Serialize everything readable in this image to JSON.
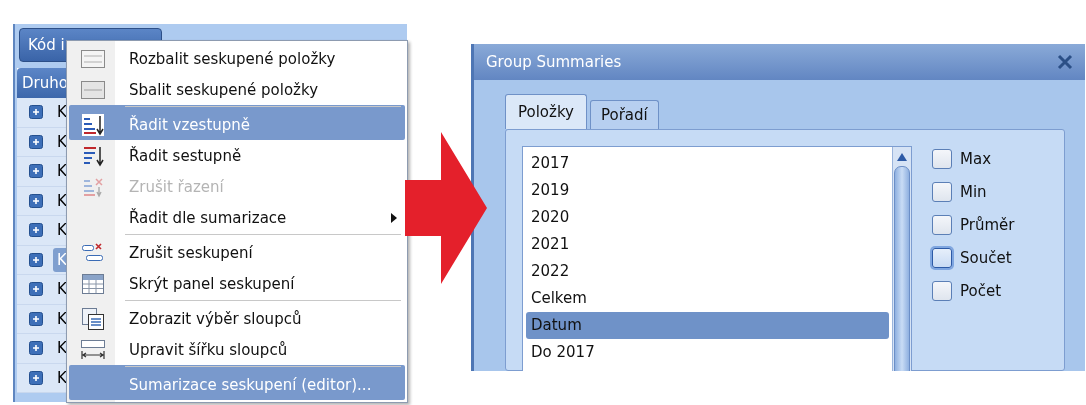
{
  "grid": {
    "group_button": "Kód i",
    "column_header": "Druho",
    "rows": [
      {
        "text": "K",
        "selected": false
      },
      {
        "text": "K",
        "selected": false
      },
      {
        "text": "K",
        "selected": false
      },
      {
        "text": "K",
        "selected": false
      },
      {
        "text": "K",
        "selected": false
      },
      {
        "text": "K",
        "selected": true
      },
      {
        "text": "K",
        "selected": false
      },
      {
        "text": "K",
        "selected": false
      },
      {
        "text": "K",
        "selected": false
      },
      {
        "text": "K",
        "selected": false
      }
    ]
  },
  "context_menu": {
    "items": [
      {
        "kind": "expand",
        "label": "Rozbalit seskupené položky",
        "selected": false,
        "disabled": false,
        "submenu": false,
        "separator_before": false
      },
      {
        "kind": "collapse",
        "label": "Sbalit seskupené položky",
        "selected": false,
        "disabled": false,
        "submenu": false,
        "separator_before": false
      },
      {
        "kind": "sort-asc",
        "label": "Řadit vzestupně",
        "selected": true,
        "disabled": false,
        "submenu": false,
        "separator_before": true
      },
      {
        "kind": "sort-desc",
        "label": "Řadit sestupně",
        "selected": false,
        "disabled": false,
        "submenu": false,
        "separator_before": false
      },
      {
        "kind": "clear-sort",
        "label": "Zrušit řazení",
        "selected": false,
        "disabled": true,
        "submenu": false,
        "separator_before": false
      },
      {
        "kind": "plain",
        "label": "Řadit dle sumarizace",
        "selected": false,
        "disabled": false,
        "submenu": true,
        "separator_before": false
      },
      {
        "kind": "ungroup",
        "label": "Zrušit seskupení",
        "selected": false,
        "disabled": false,
        "submenu": false,
        "separator_before": true
      },
      {
        "kind": "hide-panel",
        "label": "Skrýt panel seskupení",
        "selected": false,
        "disabled": false,
        "submenu": false,
        "separator_before": false
      },
      {
        "kind": "column-chooser",
        "label": "Zobrazit výběr sloupců",
        "selected": false,
        "disabled": false,
        "submenu": false,
        "separator_before": true
      },
      {
        "kind": "best-fit",
        "label": "Upravit šířku sloupců",
        "selected": false,
        "disabled": false,
        "submenu": false,
        "separator_before": false
      },
      {
        "kind": "plain",
        "label": "Sumarizace seskupení (editor)...",
        "selected": true,
        "disabled": false,
        "submenu": false,
        "separator_before": true
      }
    ]
  },
  "dialog": {
    "title": "Group Summaries",
    "tabs": [
      {
        "label": "Položky",
        "selected": true
      },
      {
        "label": "Pořadí",
        "selected": false
      }
    ],
    "list_items": [
      {
        "label": "2017",
        "selected": false
      },
      {
        "label": "2019",
        "selected": false
      },
      {
        "label": "2020",
        "selected": false
      },
      {
        "label": "2021",
        "selected": false
      },
      {
        "label": "2022",
        "selected": false
      },
      {
        "label": "Celkem",
        "selected": false
      },
      {
        "label": "Datum",
        "selected": true
      },
      {
        "label": "Do 2017",
        "selected": false
      }
    ],
    "checkboxes": [
      {
        "label": "Max",
        "checked": false,
        "focused": false
      },
      {
        "label": "Min",
        "checked": false,
        "focused": false
      },
      {
        "label": "Průměr",
        "checked": false,
        "focused": false
      },
      {
        "label": "Součet",
        "checked": false,
        "focused": true
      },
      {
        "label": "Počet",
        "checked": false,
        "focused": false
      }
    ]
  }
}
